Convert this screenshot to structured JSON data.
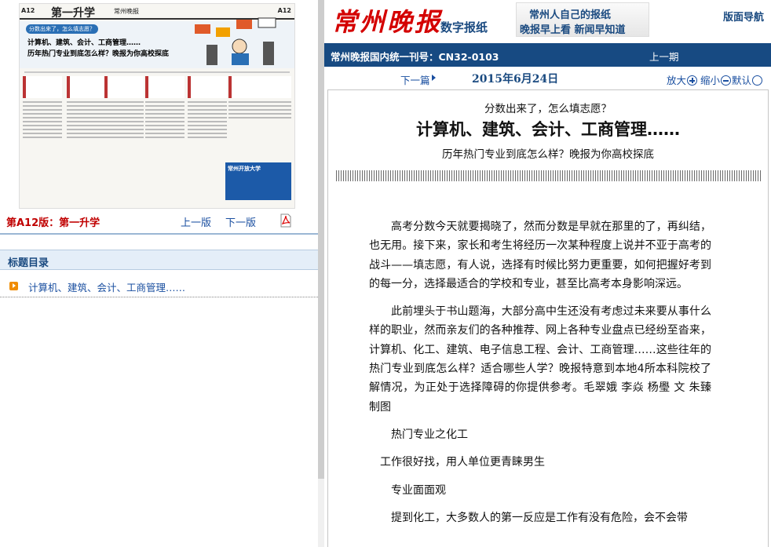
{
  "left": {
    "thumbnail": {
      "page_no": "A12",
      "section": "第一升学",
      "tag": "分数出来了，怎么填志愿？",
      "headline_line1": "计算机、建筑、会计、工商管理……",
      "headline_line2": "历年热门专业到底怎么样？晚报为你高校探底",
      "ad": "常州开放大学"
    },
    "edition_label": "第A12版：第一升学",
    "prev_page": "上一版",
    "next_page": "下一版",
    "toc_title": "标题目录",
    "toc_items": [
      "计算机、建筑、会计、工商管理……"
    ]
  },
  "header": {
    "logo": "常州晚报",
    "digital_label": "数字报纸",
    "slogan1": "常州人自己的报纸",
    "slogan2": "晚报早上看 新闻早知道",
    "nav_link": "版面导航",
    "registration": "常州晚报国内统一刊号：CN32-0103",
    "prev_issue": "上一期",
    "next_issue": "下一篇",
    "date": "2015年6月24日",
    "zoom_in": "放大",
    "zoom_out": "缩小",
    "zoom_reset": "默认"
  },
  "article": {
    "kicker": "分数出来了，怎么填志愿？",
    "headline": "计算机、建筑、会计、工商管理……",
    "subhead": "历年热门专业到底怎么样？晚报为你高校探底",
    "paragraphs": [
      "高考分数今天就要揭晓了，然而分数是早就在那里的了，再纠结，也无用。接下来，家长和考生将经历一次某种程度上说并不亚于高考的战斗——填志愿，有人说，选择有时候比努力更重要，如何把握好考到的每一分，选择最适合的学校和专业，甚至比高考本身影响深远。",
      "此前埋头于书山题海，大部分高中生还没有考虑过未来要从事什么样的职业，然而亲友们的各种推荐、网上各种专业盘点已经纷至沓来，计算机、化工、建筑、电子信息工程、会计、工商管理……这些往年的热门专业到底怎么样？适合哪些人学？晚报特意到本地4所本科院校了解情况，为正处于选择障碍的你提供参考。毛翠娥 李焱 杨璺 文 朱臻 制图",
      "热门专业之化工",
      "工作很好找，用人单位更青睐男生",
      "专业面面观",
      "提到化工，大多数人的第一反应是工作有没有危险，会不会带"
    ]
  }
}
